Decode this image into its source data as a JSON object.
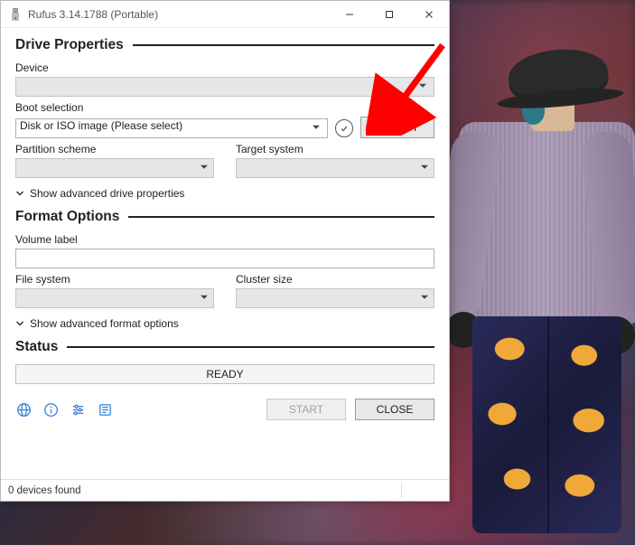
{
  "window": {
    "title": "Rufus 3.14.1788 (Portable)"
  },
  "sections": {
    "drive_properties": "Drive Properties",
    "format_options": "Format Options",
    "status": "Status"
  },
  "labels": {
    "device": "Device",
    "boot_selection": "Boot selection",
    "partition_scheme": "Partition scheme",
    "target_system": "Target system",
    "volume_label": "Volume label",
    "file_system": "File system",
    "cluster_size": "Cluster size"
  },
  "values": {
    "device": "",
    "boot_selection": "Disk or ISO image (Please select)",
    "partition_scheme": "",
    "target_system": "",
    "volume_label": "",
    "file_system": "",
    "cluster_size": ""
  },
  "toggles": {
    "adv_drive": "Show advanced drive properties",
    "adv_format": "Show advanced format options"
  },
  "buttons": {
    "select": "SELECT",
    "start": "START",
    "close": "CLOSE"
  },
  "status_text": "READY",
  "statusbar": {
    "devices": "0 devices found"
  },
  "icons": {
    "app": "usb-icon",
    "globe": "globe-icon",
    "info": "info-icon",
    "settings": "settings-icon",
    "log": "log-icon",
    "verify": "verify-icon"
  }
}
